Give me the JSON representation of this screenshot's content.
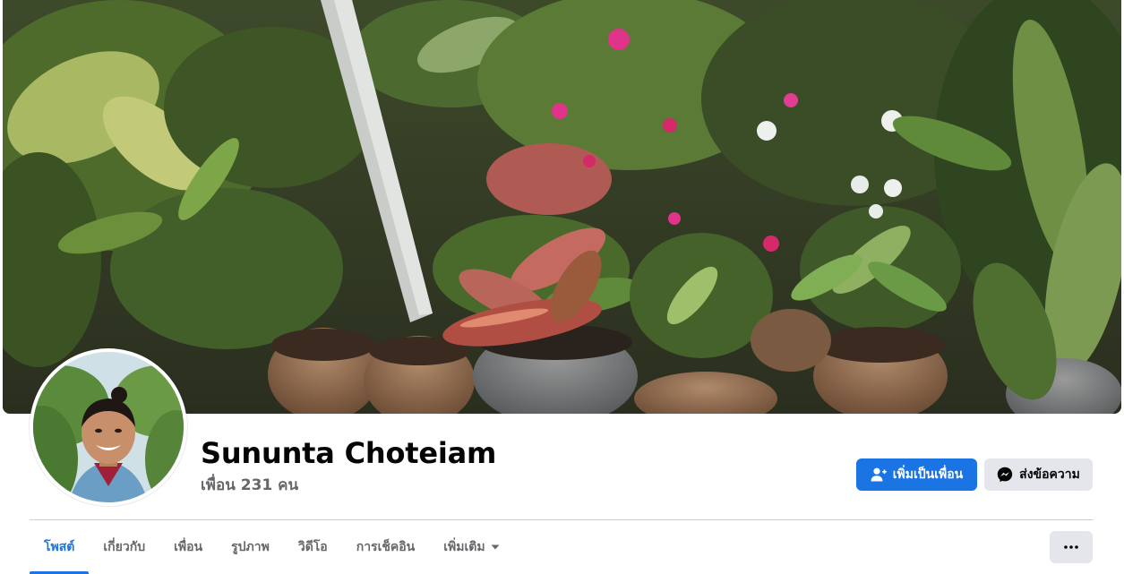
{
  "profile": {
    "name": "Sununta Choteiam",
    "friends_text": "เพื่อน 231 คน"
  },
  "actions": {
    "add_friend_label": "เพิ่มเป็นเพื่อน",
    "add_friend_icon": "add-friend-icon",
    "message_label": "ส่งข้อความ",
    "message_icon": "messenger-icon"
  },
  "tabs": [
    {
      "label": "โพสต์",
      "active": true
    },
    {
      "label": "เกี่ยวกับ",
      "active": false
    },
    {
      "label": "เพื่อน",
      "active": false
    },
    {
      "label": "รูปภาพ",
      "active": false
    },
    {
      "label": "วิดีโอ",
      "active": false
    },
    {
      "label": "การเช็คอิน",
      "active": false
    },
    {
      "label": "เพิ่มเติม",
      "active": false,
      "icon": "caret-down-icon"
    }
  ],
  "more_options_icon": "ellipsis-icon",
  "colors": {
    "accent": "#1b74e4",
    "secondary_button": "#e4e6eb",
    "text_primary": "#050505",
    "text_secondary": "#65676b",
    "divider": "#ced0d4"
  }
}
